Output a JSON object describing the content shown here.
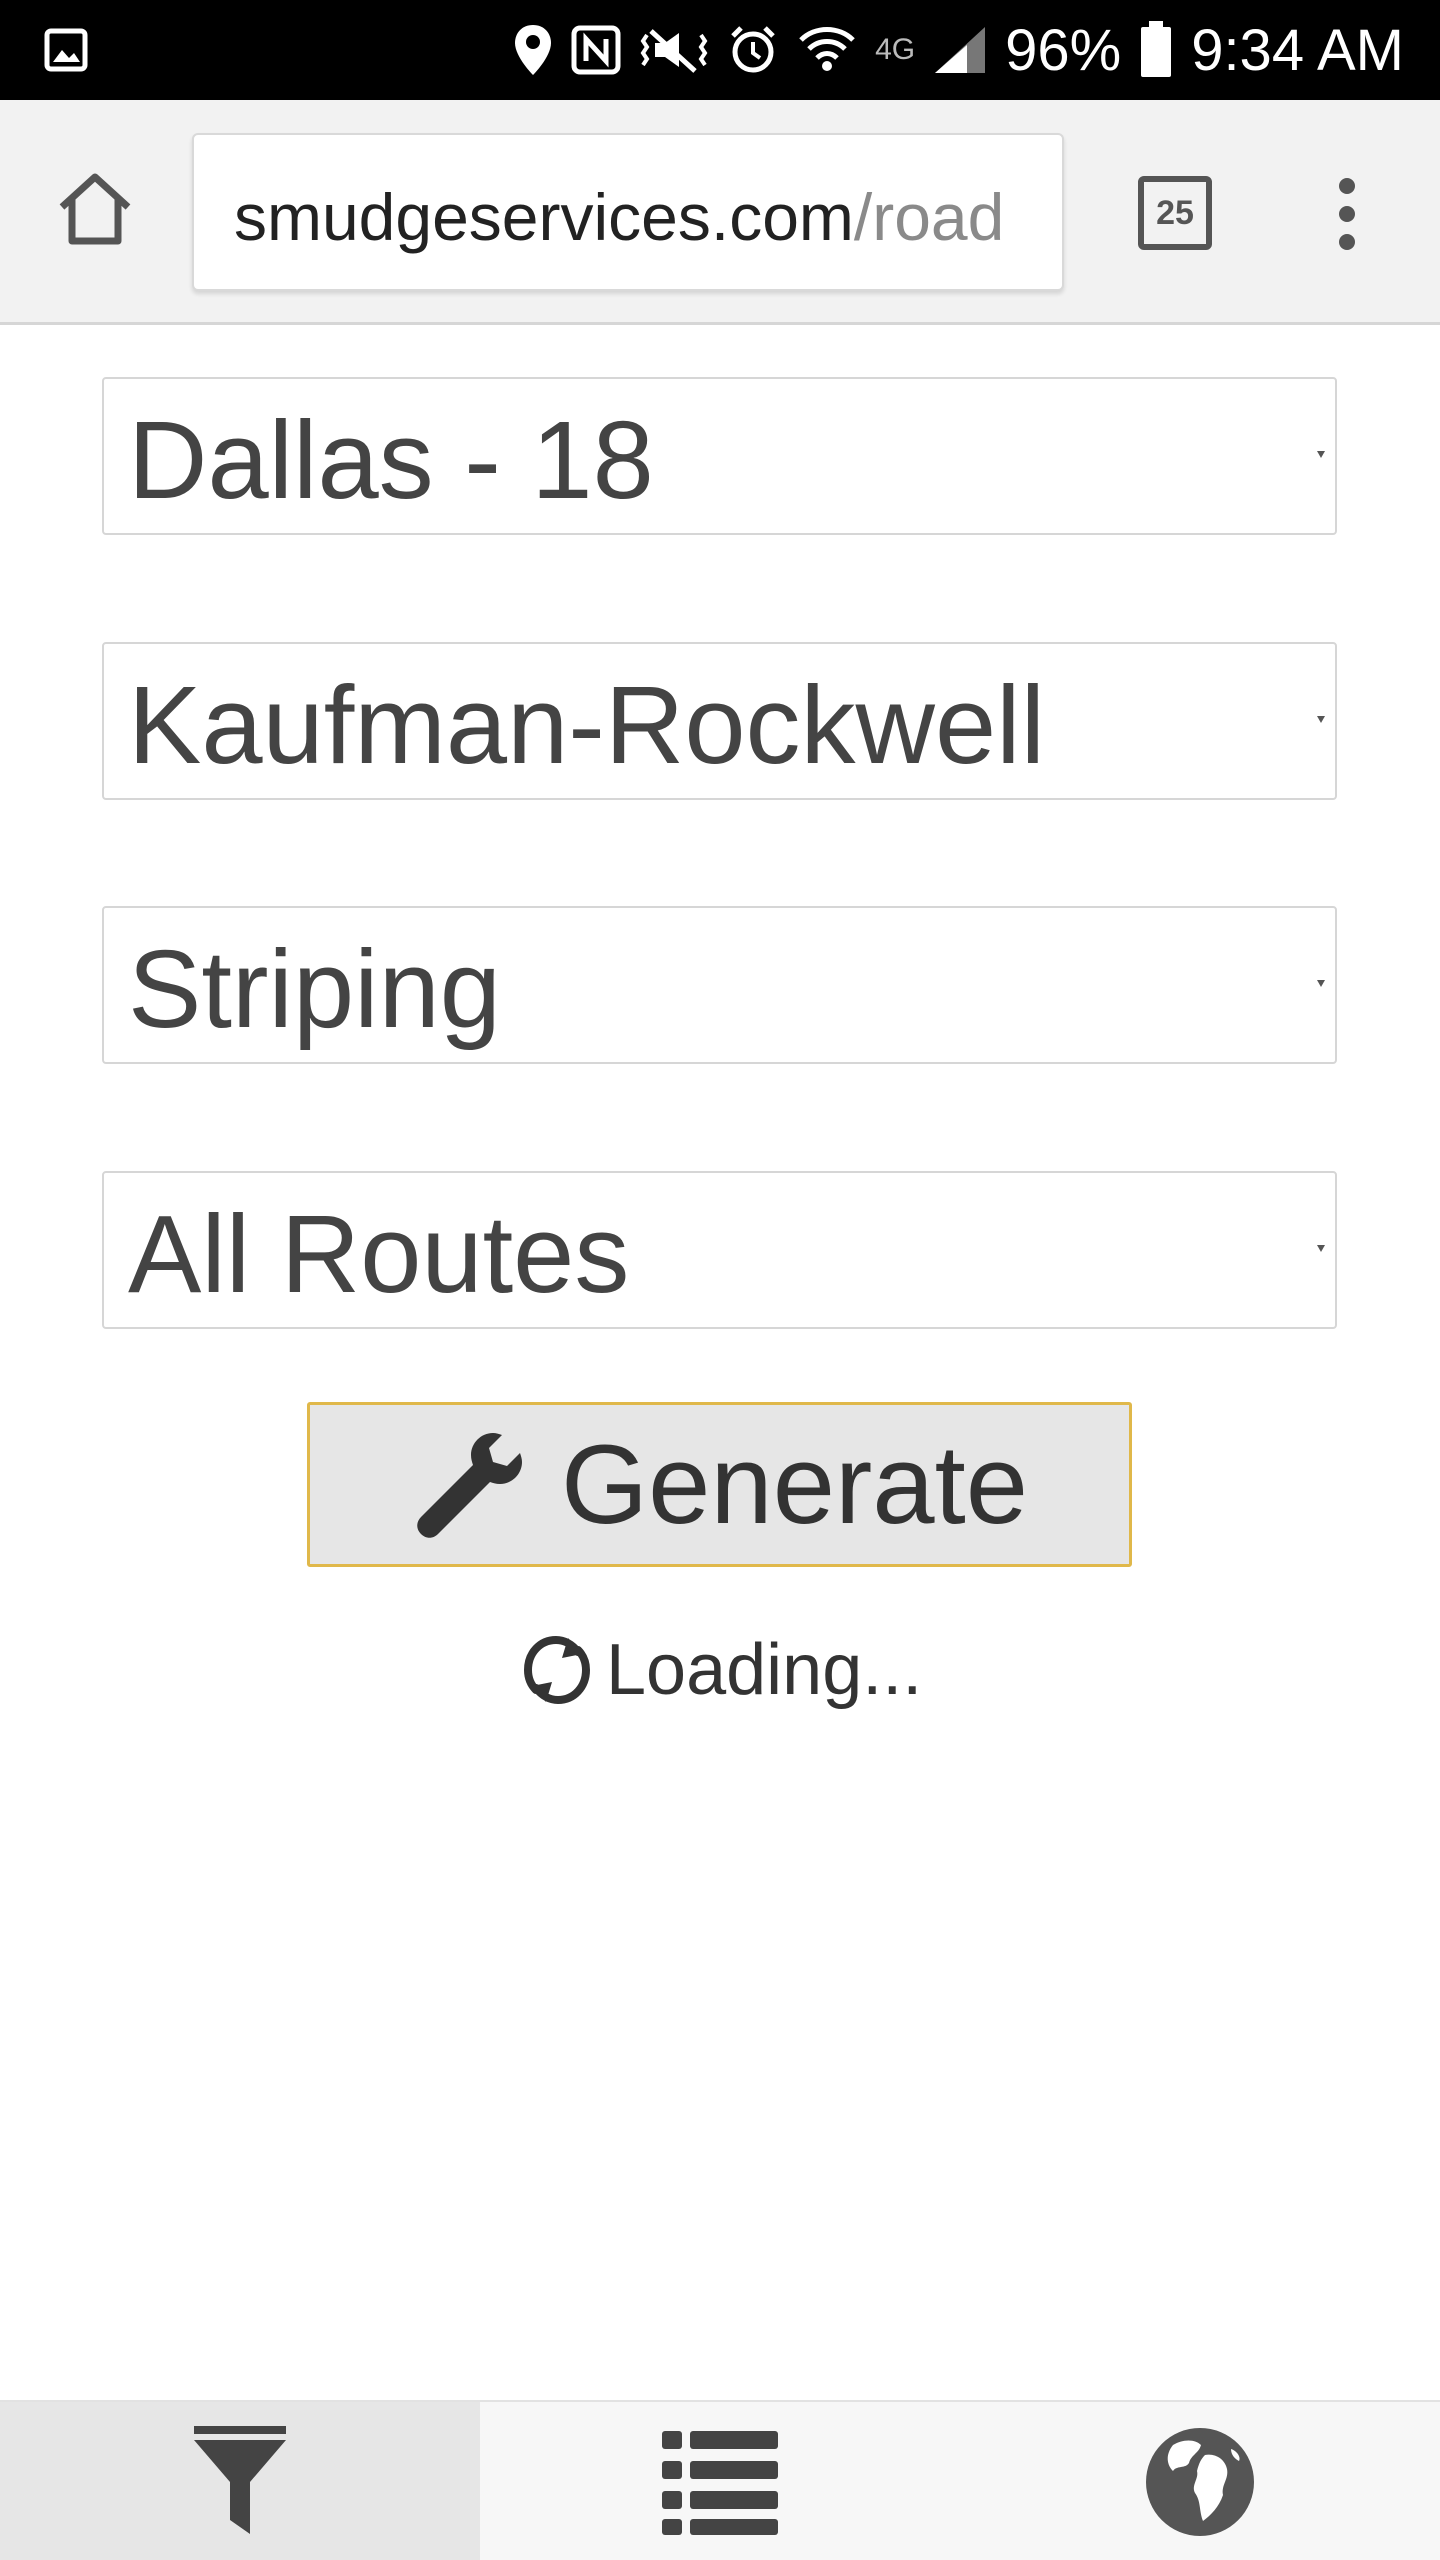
{
  "status_bar": {
    "battery_percent": "96%",
    "time": "9:34 AM",
    "network_label": "4G",
    "icons": [
      "gallery-icon",
      "location-icon",
      "nfc-icon",
      "vibrate-icon",
      "alarm-icon",
      "wifi-icon",
      "signal-icon",
      "battery-icon"
    ]
  },
  "browser": {
    "url_domain": "smudgeservices.com",
    "url_path": "/road",
    "tab_count": "25"
  },
  "form": {
    "select_1": {
      "value": "Dallas - 18"
    },
    "select_2": {
      "value": "Kaufman-Rockwell"
    },
    "select_3": {
      "value": "Striping"
    },
    "select_4": {
      "value": "All Routes"
    },
    "generate_label": "Generate",
    "loading_label": "Loading..."
  },
  "bottom_nav": {
    "items": [
      {
        "icon": "filter-icon",
        "active": true
      },
      {
        "icon": "list-icon",
        "active": false
      },
      {
        "icon": "globe-icon",
        "active": false
      }
    ]
  },
  "colors": {
    "status_bar_bg": "#000000",
    "toolbar_bg": "#f2f2f2",
    "button_border": "#e0b84a",
    "active_nav_bg": "#e6e6e6"
  }
}
